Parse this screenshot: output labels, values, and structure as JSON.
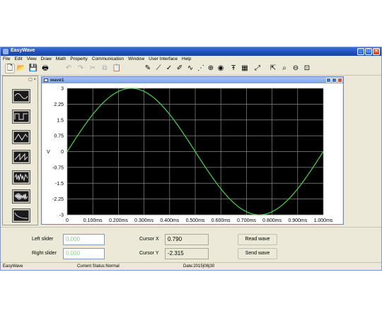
{
  "window": {
    "title": "EasyWave"
  },
  "menu": [
    "File",
    "Edit",
    "View",
    "Draw",
    "Math",
    "Property",
    "Communication",
    "Window",
    "User Interface",
    "Help"
  ],
  "wave_window": {
    "title": "wave1"
  },
  "side_header": "▢ ×",
  "toolbar_icons": [
    "new-file-icon",
    "open-folder-icon",
    "save-icon",
    "print-icon",
    "undo-icon",
    "redo-icon",
    "cut-icon",
    "copy-icon",
    "paste-icon",
    "pen-icon",
    "line-pen-icon",
    "check-pen-icon",
    "marker-pen-icon",
    "sine-pen-icon",
    "dotted-cursor-icon",
    "wave-plus-icon",
    "record-icon",
    "tt-icon",
    "grid-icon",
    "autoscale-icon",
    "zoom-out-icon",
    "zoom-in-icon",
    "zoom-fit-icon",
    "zoom-box-icon"
  ],
  "side_waves": [
    "sine-wave-icon",
    "square-wave-icon",
    "triangle-wave-icon",
    "ramp-wave-icon",
    "noise-wave-icon",
    "am-wave-icon",
    "exp-wave-icon"
  ],
  "chart_data": {
    "type": "line",
    "ylabel": "V",
    "xlabel": "",
    "y_ticks": [
      "3",
      "2.25",
      "1.5",
      "0.75",
      "0",
      "-0.75",
      "-1.5",
      "-2.25",
      "-3"
    ],
    "x_ticks": [
      "0",
      "0.100ms",
      "0.200ms",
      "0.300ms",
      "0.400ms",
      "0.500ms",
      "0.600ms",
      "0.700ms",
      "0.800ms",
      "0.900ms",
      "1.000ms"
    ],
    "xlim": [
      0,
      1.0
    ],
    "ylim": [
      -3,
      3
    ],
    "grid": true,
    "background": "#000000",
    "line_color": "#48d848",
    "series": [
      {
        "function": "sine",
        "amplitude": 3,
        "period": 1.0,
        "phase": 0
      }
    ]
  },
  "controls": {
    "left_slider_label": "Left slider",
    "left_slider_value": "0.000",
    "right_slider_label": "Right slider",
    "right_slider_value": "0.000",
    "cursor_x_label": "Cursor X",
    "cursor_x_value": "0.790",
    "cursor_y_label": "Cursor Y",
    "cursor_y_value": "-2.315",
    "read_wave_label": "Read wave",
    "send_wave_label": "Send wave"
  },
  "status": {
    "app": "EasyWave",
    "current_status": "Current Status:Normal",
    "date": "Date:2015|06|30"
  }
}
